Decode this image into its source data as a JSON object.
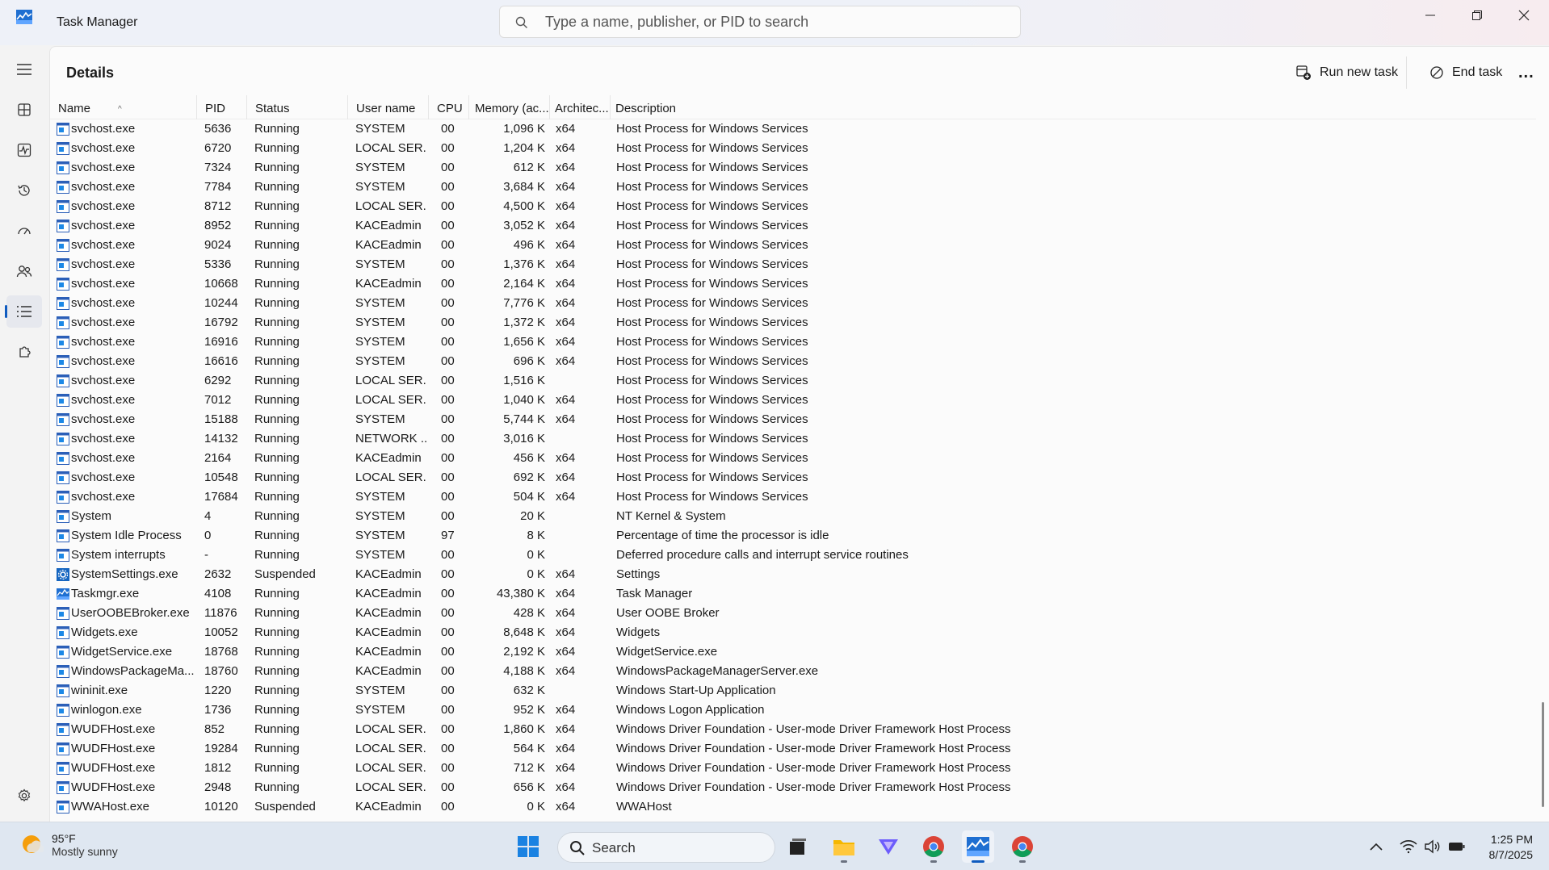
{
  "app": {
    "title": "Task Manager"
  },
  "search": {
    "placeholder": "Type a name, publisher, or PID to search"
  },
  "page": {
    "title": "Details"
  },
  "commands": {
    "run_new_task": "Run new task",
    "end_task": "End task",
    "more": "..."
  },
  "columns": {
    "name": "Name",
    "pid": "PID",
    "status": "Status",
    "user": "User name",
    "cpu": "CPU",
    "memory": "Memory (ac...",
    "arch": "Architec...",
    "description": "Description"
  },
  "rows": [
    {
      "name": "svchost.exe",
      "pid": "5636",
      "status": "Running",
      "user": "SYSTEM",
      "cpu": "00",
      "mem": "1,096 K",
      "arch": "x64",
      "desc": "Host Process for Windows Services",
      "icon": "generic"
    },
    {
      "name": "svchost.exe",
      "pid": "6720",
      "status": "Running",
      "user": "LOCAL SER...",
      "cpu": "00",
      "mem": "1,204 K",
      "arch": "x64",
      "desc": "Host Process for Windows Services",
      "icon": "generic"
    },
    {
      "name": "svchost.exe",
      "pid": "7324",
      "status": "Running",
      "user": "SYSTEM",
      "cpu": "00",
      "mem": "612 K",
      "arch": "x64",
      "desc": "Host Process for Windows Services",
      "icon": "generic"
    },
    {
      "name": "svchost.exe",
      "pid": "7784",
      "status": "Running",
      "user": "SYSTEM",
      "cpu": "00",
      "mem": "3,684 K",
      "arch": "x64",
      "desc": "Host Process for Windows Services",
      "icon": "generic"
    },
    {
      "name": "svchost.exe",
      "pid": "8712",
      "status": "Running",
      "user": "LOCAL SER...",
      "cpu": "00",
      "mem": "4,500 K",
      "arch": "x64",
      "desc": "Host Process for Windows Services",
      "icon": "generic"
    },
    {
      "name": "svchost.exe",
      "pid": "8952",
      "status": "Running",
      "user": "KACEadmin",
      "cpu": "00",
      "mem": "3,052 K",
      "arch": "x64",
      "desc": "Host Process for Windows Services",
      "icon": "generic"
    },
    {
      "name": "svchost.exe",
      "pid": "9024",
      "status": "Running",
      "user": "KACEadmin",
      "cpu": "00",
      "mem": "496 K",
      "arch": "x64",
      "desc": "Host Process for Windows Services",
      "icon": "generic"
    },
    {
      "name": "svchost.exe",
      "pid": "5336",
      "status": "Running",
      "user": "SYSTEM",
      "cpu": "00",
      "mem": "1,376 K",
      "arch": "x64",
      "desc": "Host Process for Windows Services",
      "icon": "generic"
    },
    {
      "name": "svchost.exe",
      "pid": "10668",
      "status": "Running",
      "user": "KACEadmin",
      "cpu": "00",
      "mem": "2,164 K",
      "arch": "x64",
      "desc": "Host Process for Windows Services",
      "icon": "generic"
    },
    {
      "name": "svchost.exe",
      "pid": "10244",
      "status": "Running",
      "user": "SYSTEM",
      "cpu": "00",
      "mem": "7,776 K",
      "arch": "x64",
      "desc": "Host Process for Windows Services",
      "icon": "generic"
    },
    {
      "name": "svchost.exe",
      "pid": "16792",
      "status": "Running",
      "user": "SYSTEM",
      "cpu": "00",
      "mem": "1,372 K",
      "arch": "x64",
      "desc": "Host Process for Windows Services",
      "icon": "generic"
    },
    {
      "name": "svchost.exe",
      "pid": "16916",
      "status": "Running",
      "user": "SYSTEM",
      "cpu": "00",
      "mem": "1,656 K",
      "arch": "x64",
      "desc": "Host Process for Windows Services",
      "icon": "generic"
    },
    {
      "name": "svchost.exe",
      "pid": "16616",
      "status": "Running",
      "user": "SYSTEM",
      "cpu": "00",
      "mem": "696 K",
      "arch": "x64",
      "desc": "Host Process for Windows Services",
      "icon": "generic"
    },
    {
      "name": "svchost.exe",
      "pid": "6292",
      "status": "Running",
      "user": "LOCAL SER...",
      "cpu": "00",
      "mem": "1,516 K",
      "arch": "",
      "desc": "Host Process for Windows Services",
      "icon": "generic"
    },
    {
      "name": "svchost.exe",
      "pid": "7012",
      "status": "Running",
      "user": "LOCAL SER...",
      "cpu": "00",
      "mem": "1,040 K",
      "arch": "x64",
      "desc": "Host Process for Windows Services",
      "icon": "generic"
    },
    {
      "name": "svchost.exe",
      "pid": "15188",
      "status": "Running",
      "user": "SYSTEM",
      "cpu": "00",
      "mem": "5,744 K",
      "arch": "x64",
      "desc": "Host Process for Windows Services",
      "icon": "generic"
    },
    {
      "name": "svchost.exe",
      "pid": "14132",
      "status": "Running",
      "user": "NETWORK ...",
      "cpu": "00",
      "mem": "3,016 K",
      "arch": "",
      "desc": "Host Process for Windows Services",
      "icon": "generic"
    },
    {
      "name": "svchost.exe",
      "pid": "2164",
      "status": "Running",
      "user": "KACEadmin",
      "cpu": "00",
      "mem": "456 K",
      "arch": "x64",
      "desc": "Host Process for Windows Services",
      "icon": "generic"
    },
    {
      "name": "svchost.exe",
      "pid": "10548",
      "status": "Running",
      "user": "LOCAL SER...",
      "cpu": "00",
      "mem": "692 K",
      "arch": "x64",
      "desc": "Host Process for Windows Services",
      "icon": "generic"
    },
    {
      "name": "svchost.exe",
      "pid": "17684",
      "status": "Running",
      "user": "SYSTEM",
      "cpu": "00",
      "mem": "504 K",
      "arch": "x64",
      "desc": "Host Process for Windows Services",
      "icon": "generic"
    },
    {
      "name": "System",
      "pid": "4",
      "status": "Running",
      "user": "SYSTEM",
      "cpu": "00",
      "mem": "20 K",
      "arch": "",
      "desc": "NT Kernel & System",
      "icon": "generic"
    },
    {
      "name": "System Idle Process",
      "pid": "0",
      "status": "Running",
      "user": "SYSTEM",
      "cpu": "97",
      "mem": "8 K",
      "arch": "",
      "desc": "Percentage of time the processor is idle",
      "icon": "generic"
    },
    {
      "name": "System interrupts",
      "pid": "-",
      "status": "Running",
      "user": "SYSTEM",
      "cpu": "00",
      "mem": "0 K",
      "arch": "",
      "desc": "Deferred procedure calls and interrupt service routines",
      "icon": "generic"
    },
    {
      "name": "SystemSettings.exe",
      "pid": "2632",
      "status": "Suspended",
      "user": "KACEadmin",
      "cpu": "00",
      "mem": "0 K",
      "arch": "x64",
      "desc": "Settings",
      "icon": "gear"
    },
    {
      "name": "Taskmgr.exe",
      "pid": "4108",
      "status": "Running",
      "user": "KACEadmin",
      "cpu": "00",
      "mem": "43,380 K",
      "arch": "x64",
      "desc": "Task Manager",
      "icon": "taskmgr"
    },
    {
      "name": "UserOOBEBroker.exe",
      "pid": "11876",
      "status": "Running",
      "user": "KACEadmin",
      "cpu": "00",
      "mem": "428 K",
      "arch": "x64",
      "desc": "User OOBE Broker",
      "icon": "generic"
    },
    {
      "name": "Widgets.exe",
      "pid": "10052",
      "status": "Running",
      "user": "KACEadmin",
      "cpu": "00",
      "mem": "8,648 K",
      "arch": "x64",
      "desc": "Widgets",
      "icon": "generic"
    },
    {
      "name": "WidgetService.exe",
      "pid": "18768",
      "status": "Running",
      "user": "KACEadmin",
      "cpu": "00",
      "mem": "2,192 K",
      "arch": "x64",
      "desc": "WidgetService.exe",
      "icon": "generic"
    },
    {
      "name": "WindowsPackageMa...",
      "pid": "18760",
      "status": "Running",
      "user": "KACEadmin",
      "cpu": "00",
      "mem": "4,188 K",
      "arch": "x64",
      "desc": "WindowsPackageManagerServer.exe",
      "icon": "generic"
    },
    {
      "name": "wininit.exe",
      "pid": "1220",
      "status": "Running",
      "user": "SYSTEM",
      "cpu": "00",
      "mem": "632 K",
      "arch": "",
      "desc": "Windows Start-Up Application",
      "icon": "generic"
    },
    {
      "name": "winlogon.exe",
      "pid": "1736",
      "status": "Running",
      "user": "SYSTEM",
      "cpu": "00",
      "mem": "952 K",
      "arch": "x64",
      "desc": "Windows Logon Application",
      "icon": "generic"
    },
    {
      "name": "WUDFHost.exe",
      "pid": "852",
      "status": "Running",
      "user": "LOCAL SER...",
      "cpu": "00",
      "mem": "1,860 K",
      "arch": "x64",
      "desc": "Windows Driver Foundation - User-mode Driver Framework Host Process",
      "icon": "generic"
    },
    {
      "name": "WUDFHost.exe",
      "pid": "19284",
      "status": "Running",
      "user": "LOCAL SER...",
      "cpu": "00",
      "mem": "564 K",
      "arch": "x64",
      "desc": "Windows Driver Foundation - User-mode Driver Framework Host Process",
      "icon": "generic"
    },
    {
      "name": "WUDFHost.exe",
      "pid": "1812",
      "status": "Running",
      "user": "LOCAL SER...",
      "cpu": "00",
      "mem": "712 K",
      "arch": "x64",
      "desc": "Windows Driver Foundation - User-mode Driver Framework Host Process",
      "icon": "generic"
    },
    {
      "name": "WUDFHost.exe",
      "pid": "2948",
      "status": "Running",
      "user": "LOCAL SER...",
      "cpu": "00",
      "mem": "656 K",
      "arch": "x64",
      "desc": "Windows Driver Foundation - User-mode Driver Framework Host Process",
      "icon": "generic"
    },
    {
      "name": "WWAHost.exe",
      "pid": "10120",
      "status": "Suspended",
      "user": "KACEadmin",
      "cpu": "00",
      "mem": "0 K",
      "arch": "x64",
      "desc": "WWAHost",
      "icon": "generic"
    }
  ],
  "taskbar": {
    "weather_temp": "95°F",
    "weather_condition": "Mostly sunny",
    "search_label": "Search",
    "time": "1:25 PM",
    "date": "8/7/2025"
  },
  "colors": {
    "accent": "#0f5bbf",
    "panel": "#fbfbfb",
    "background": "#f3f3f3"
  }
}
